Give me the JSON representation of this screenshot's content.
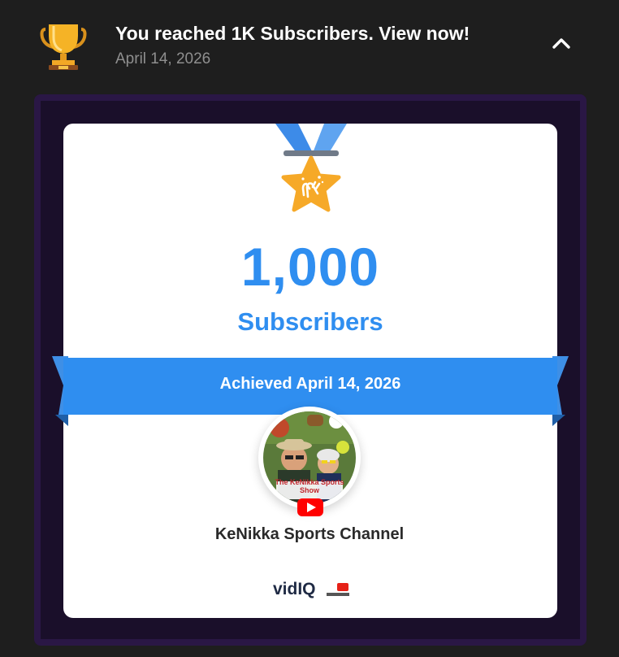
{
  "notification": {
    "title": "You reached 1K Subscribers. View now!",
    "date": "April 14, 2026",
    "icon": "trophy-icon",
    "collapse_icon": "chevron-up-icon"
  },
  "card": {
    "count": "1,000",
    "count_label": "Subscribers",
    "achieved_text": "Achieved April 14, 2026",
    "channel_name": "KeNikka Sports Channel",
    "avatar_caption": "The KeNikka Sports Show",
    "brand_logo": {
      "vid": "vid",
      "iq": "IQ"
    },
    "yt_cert_label": "YouTube"
  },
  "colors": {
    "page_background": "#1e1e1e",
    "accent_blue": "#2f8ef0",
    "frame_purple": "#2a1745",
    "medal_gold": "#f6a928"
  }
}
